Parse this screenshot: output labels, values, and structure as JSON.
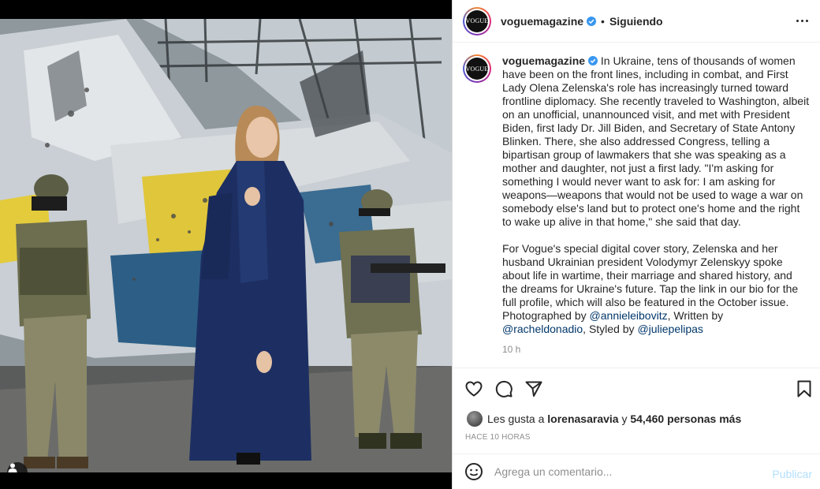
{
  "post": {
    "username": "voguemagazine",
    "avatar_text": "VOGUE",
    "follow_label": "Siguiendo",
    "separator": "•",
    "caption_para1": "In Ukraine, tens of thousands of women have been on the front lines, including in combat, and First Lady Olena Zelenska's role has increasingly turned toward frontline diplomacy. She recently traveled to Washington, albeit on an unofficial, unannounced visit, and met with President Biden, first lady Dr. Jill Biden, and Secretary of State Antony Blinken. There, she also addressed Congress, telling a bipartisan group of lawmakers that she was speaking as a mother and daughter, not just a first lady. \"I'm asking for something I would never want to ask for: I am asking for weapons—weapons that would not be used to wage a war on somebody else's land but to protect one's home and the right to wake up alive in that home,\" she said that day.",
    "caption_para2_text": "For Vogue's special digital cover story, Zelenska and her husband Ukrainian president Volodymyr Zelenskyy spoke about life in wartime, their marriage and shared history, and the dreams for Ukraine's future. Tap the link in our bio for the full profile, which will also be featured in the October issue. Photographed by",
    "mention_1": "@annieleibovitz",
    "written_by": ", Written by ",
    "mention_2": "@racheldonadio",
    "styled_by": ", Styled by",
    "mention_3": "@juliepelipas",
    "time": "10 h"
  },
  "likes": {
    "prefix": "Les gusta a",
    "user": "lorenasaravia",
    "joiner": "y",
    "count_text": "54,460 personas más"
  },
  "posted_ago": "HACE 10 HORAS",
  "comment_box": {
    "placeholder": "Agrega un comentario...",
    "publish_label": "Publicar"
  },
  "icons": [
    "verified-icon",
    "more-options-icon",
    "heart-icon",
    "comment-icon",
    "share-icon",
    "save-icon",
    "emoji-icon",
    "tagged-user-icon"
  ],
  "colors": {
    "verified": "#3897f0",
    "link": "#00376b",
    "publish_disabled": "#b2dffc",
    "muted": "#8e8e8e"
  }
}
